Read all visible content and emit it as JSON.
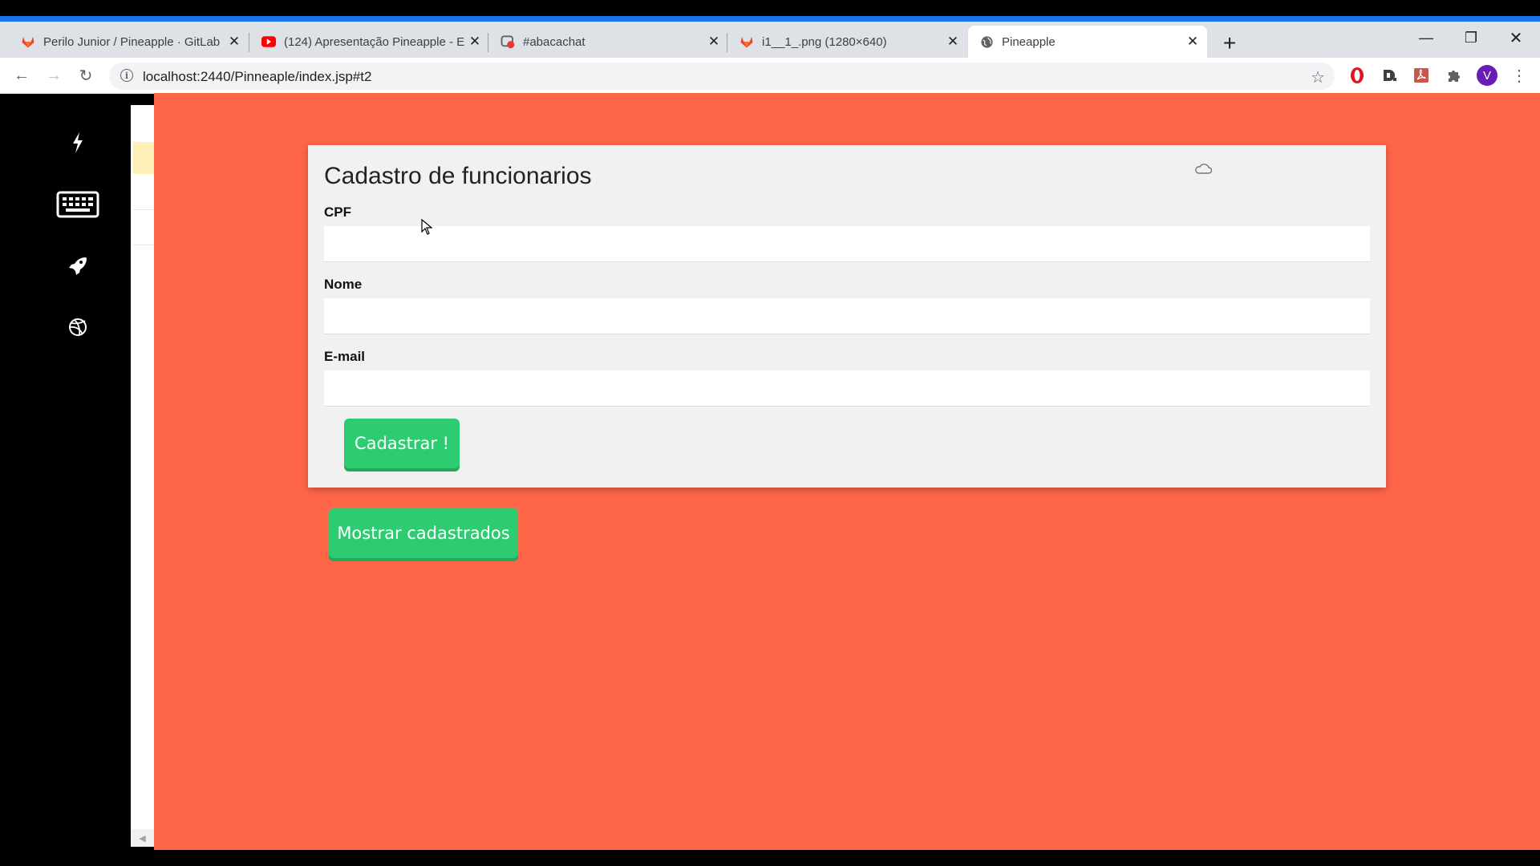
{
  "browser": {
    "tabs": [
      {
        "title": "Perilo Junior / Pineapple · GitLab",
        "icon": "gitlab-icon"
      },
      {
        "title": "(124) Apresentação Pineapple - E",
        "icon": "youtube-icon"
      },
      {
        "title": "#abacachat",
        "icon": "chat-app-icon"
      },
      {
        "title": "i1__1_.png (1280×640)",
        "icon": "gitlab-icon"
      },
      {
        "title": "Pineapple",
        "icon": "globe-icon",
        "active": true
      }
    ],
    "url": "localhost:2440/Pinneaple/index.jsp#t2",
    "profile_initial": "V"
  },
  "sidebar": {
    "items": [
      {
        "icon": "lightning-icon"
      },
      {
        "icon": "keyboard-icon"
      },
      {
        "icon": "rocket-icon"
      },
      {
        "icon": "dribbble-icon"
      }
    ]
  },
  "form": {
    "title": "Cadastro de funcionarios",
    "fields": [
      {
        "label": "CPF",
        "value": ""
      },
      {
        "label": "Nome",
        "value": ""
      },
      {
        "label": "E-mail",
        "value": ""
      }
    ],
    "submit_label": "Cadastrar !"
  },
  "show_button_label": "Mostrar cadastrados",
  "colors": {
    "page_background": "#ff6549",
    "button_green": "#2ecc71",
    "card_background": "#f1f1f1"
  }
}
